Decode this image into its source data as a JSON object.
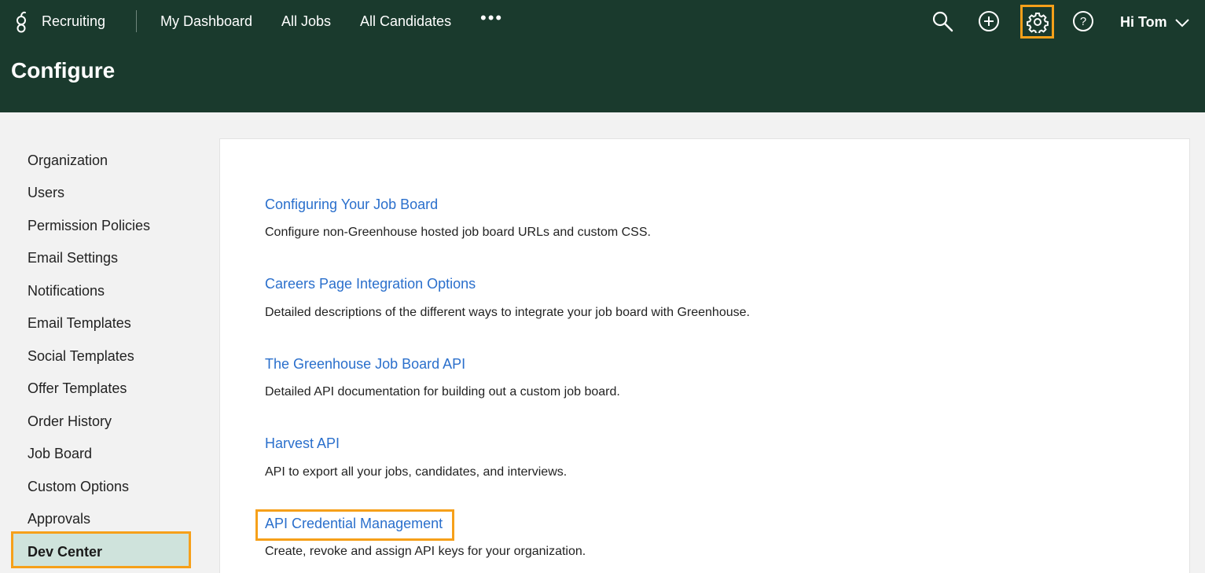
{
  "header": {
    "app_name": "Recruiting",
    "nav": [
      "My Dashboard",
      "All Jobs",
      "All Candidates"
    ],
    "more": "•••",
    "greeting": "Hi Tom",
    "page_title": "Configure"
  },
  "sidebar": {
    "items": [
      "Organization",
      "Users",
      "Permission Policies",
      "Email Settings",
      "Notifications",
      "Email Templates",
      "Social Templates",
      "Offer Templates",
      "Order History",
      "Job Board",
      "Custom Options",
      "Approvals"
    ],
    "active": "Dev Center"
  },
  "entries": [
    {
      "title": "Configuring Your Job Board",
      "desc": "Configure non-Greenhouse hosted job board URLs and custom CSS."
    },
    {
      "title": "Careers Page Integration Options",
      "desc": "Detailed descriptions of the different ways to integrate your job board with Greenhouse."
    },
    {
      "title": "The Greenhouse Job Board API",
      "desc": "Detailed API documentation for building out a custom job board."
    },
    {
      "title": "Harvest API",
      "desc": "API to export all your jobs, candidates, and interviews."
    },
    {
      "title": "API Credential Management",
      "desc": "Create, revoke and assign API keys for your organization."
    }
  ],
  "colors": {
    "header_bg": "#1a3a2d",
    "highlight": "#f6a01a",
    "link": "#2a6fcc",
    "active_bg": "#cfe3dc"
  },
  "icons": {
    "logo": "greenhouse-g-logo",
    "search": "search-icon",
    "add": "plus-circle-icon",
    "settings": "gear-icon",
    "help": "question-circle-icon",
    "user_menu": "chevron-down-icon"
  }
}
